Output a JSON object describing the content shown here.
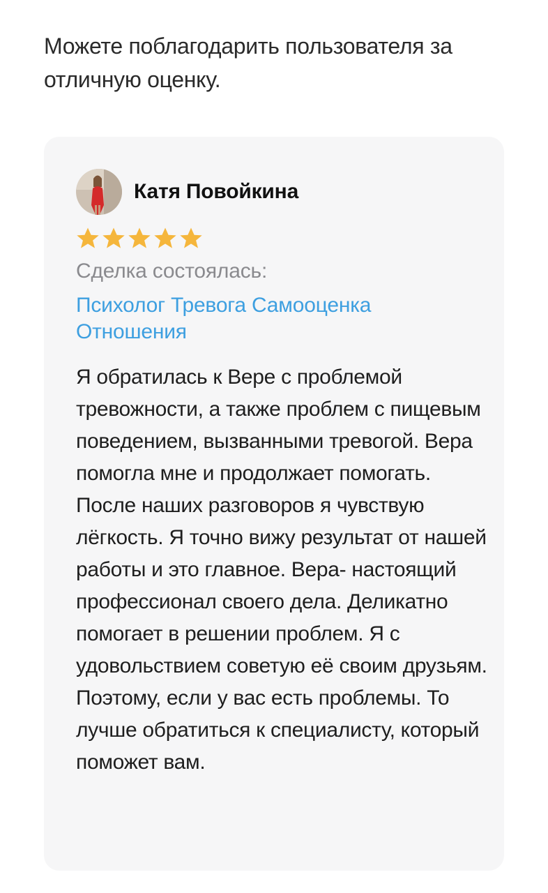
{
  "intro": {
    "text": "Можете поблагодарить пользователя за отличную оценку."
  },
  "review": {
    "author_name": "Катя Повойкина",
    "rating": 5,
    "rating_max": 5,
    "star_color": "#f5b63c",
    "deal_label": "Сделка состоялась:",
    "deal_tags": "Психолог Тревога Самооценка Отношения",
    "link_color": "#3d9fe0",
    "text": "Я обратилась к Вере с проблемой тревожности, а также проблем с пищевым поведением, вызванными тревогой. Вера помогла мне и продолжает помогать. После наших разговоров я чувствую лёгкость. Я точно вижу результат от нашей работы и это главное. Вера- настоящий профессионал своего дела. Деликатно помогает в решении проблем. Я с удовольствием советую её своим друзьям. Поэтому, если у вас есть проблемы. То лучше обратиться к специалисту, который поможет вам."
  }
}
